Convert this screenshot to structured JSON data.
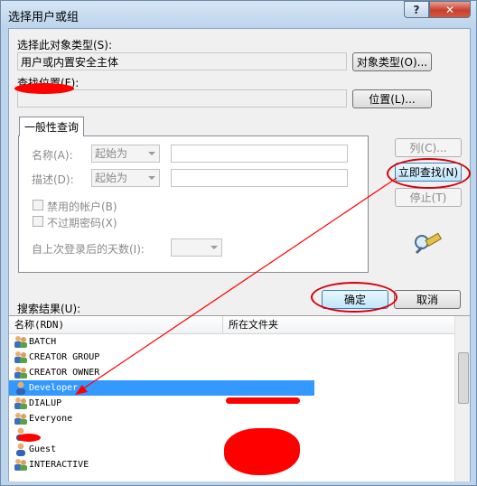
{
  "window": {
    "title": "选择用户或组"
  },
  "object_type": {
    "label": "选择此对象类型(S):",
    "value": "用户或内置安全主体",
    "button": "对象类型(O)..."
  },
  "location": {
    "label": "查找位置(F):",
    "button": "位置(L)..."
  },
  "query": {
    "tab": "一般性查询",
    "name_label": "名称(A):",
    "name_mode": "起始为",
    "desc_label": "描述(D):",
    "desc_mode": "起始为",
    "disabled_accounts": "禁用的帐户(B)",
    "non_expiring_pwd": "不过期密码(X)",
    "days_label": "自上次登录后的天数(I):"
  },
  "side_buttons": {
    "columns": "列(C)...",
    "find_now": "立即查找(N)",
    "stop": "停止(T)"
  },
  "results": {
    "label": "搜索结果(U):",
    "ok": "确定",
    "cancel": "取消",
    "columns": [
      "名称(RDN)",
      "所在文件夹"
    ],
    "rows": [
      {
        "name": "BATCH",
        "icon": "group-icon"
      },
      {
        "name": "CREATOR GROUP",
        "icon": "group-icon"
      },
      {
        "name": "CREATOR OWNER",
        "icon": "group-icon"
      },
      {
        "name": "Developer",
        "icon": "user-icon",
        "selected": true
      },
      {
        "name": "DIALUP",
        "icon": "group-icon"
      },
      {
        "name": "Everyone",
        "icon": "group-icon"
      },
      {
        "name": "",
        "icon": "user-icon"
      },
      {
        "name": "Guest",
        "icon": "user-icon"
      },
      {
        "name": "INTERACTIVE",
        "icon": "group-icon"
      }
    ]
  },
  "colors": {
    "selection": "#3399ff",
    "annotation": "#ff0000",
    "frame": "#bcd4ec"
  }
}
